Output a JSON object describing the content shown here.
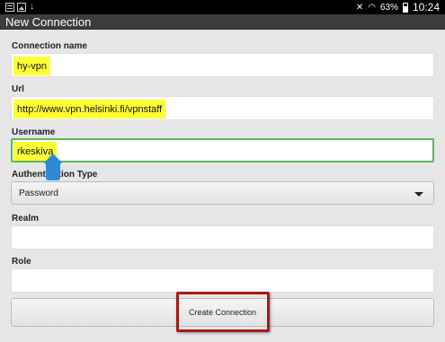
{
  "status_bar": {
    "battery": "63%",
    "time": "10:24",
    "left_icons": [
      "message-icon",
      "image-icon",
      "download-icon"
    ],
    "right_icons": [
      "mute-icon",
      "wifi-icon",
      "battery-icon"
    ]
  },
  "title": "New Connection",
  "form": {
    "connection_name": {
      "label": "Connection name",
      "value": "hy-vpn"
    },
    "url": {
      "label": "Url",
      "value": "http://www.vpn.helsinki.fi/vpnstaff"
    },
    "username": {
      "label": "Username",
      "value": "rkeskiva"
    },
    "auth_type": {
      "label": "Authentication Type",
      "value": "Password"
    },
    "realm": {
      "label": "Realm",
      "value": ""
    },
    "role": {
      "label": "Role",
      "value": ""
    }
  },
  "create_button": "Create Connection",
  "colors": {
    "field_highlight": "#ffff33",
    "focus_border": "#5cb85c",
    "annotation_box": "#a8191b",
    "title_bar": "#3d3d3d"
  }
}
